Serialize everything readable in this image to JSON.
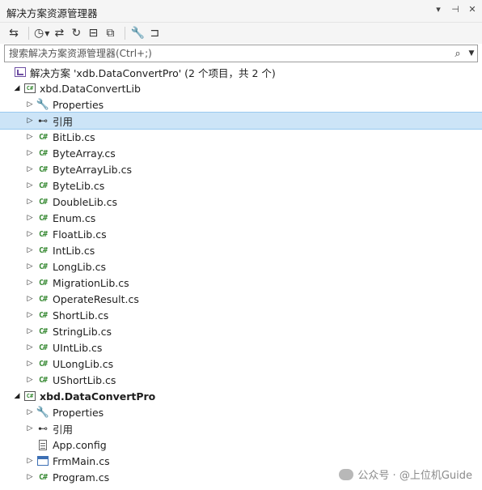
{
  "window": {
    "title": "解决方案资源管理器"
  },
  "title_actions": [
    {
      "name": "dropdown-icon",
      "glyph": "▾"
    },
    {
      "name": "pin-icon",
      "glyph": "⊣"
    },
    {
      "name": "close-icon",
      "glyph": "✕"
    }
  ],
  "search": {
    "placeholder": "搜索解决方案资源管理器(Ctrl+;)"
  },
  "tree": [
    {
      "level": 0,
      "expander": "",
      "icon": "solution-icon",
      "label": "解决方案 'xdb.DataConvertPro' (2 个项目，共 2 个)",
      "bold": false
    },
    {
      "level": 1,
      "expander": "expanded",
      "icon": "csharp-project-icon",
      "label": "xbd.DataConvertLib",
      "bold": false
    },
    {
      "level": 2,
      "expander": "collapsed",
      "icon": "wrench-icon",
      "label": "Properties",
      "bold": false
    },
    {
      "level": 2,
      "expander": "collapsed",
      "icon": "references-icon",
      "label": "引用",
      "bold": false,
      "selected": true
    },
    {
      "level": 2,
      "expander": "collapsed",
      "icon": "csharp-file-icon",
      "label": "BitLib.cs",
      "bold": false
    },
    {
      "level": 2,
      "expander": "collapsed",
      "icon": "csharp-file-icon",
      "label": "ByteArray.cs",
      "bold": false
    },
    {
      "level": 2,
      "expander": "collapsed",
      "icon": "csharp-file-icon",
      "label": "ByteArrayLib.cs",
      "bold": false
    },
    {
      "level": 2,
      "expander": "collapsed",
      "icon": "csharp-file-icon",
      "label": "ByteLib.cs",
      "bold": false
    },
    {
      "level": 2,
      "expander": "collapsed",
      "icon": "csharp-file-icon",
      "label": "DoubleLib.cs",
      "bold": false
    },
    {
      "level": 2,
      "expander": "collapsed",
      "icon": "csharp-file-icon",
      "label": "Enum.cs",
      "bold": false
    },
    {
      "level": 2,
      "expander": "collapsed",
      "icon": "csharp-file-icon",
      "label": "FloatLib.cs",
      "bold": false
    },
    {
      "level": 2,
      "expander": "collapsed",
      "icon": "csharp-file-icon",
      "label": "IntLib.cs",
      "bold": false
    },
    {
      "level": 2,
      "expander": "collapsed",
      "icon": "csharp-file-icon",
      "label": "LongLib.cs",
      "bold": false
    },
    {
      "level": 2,
      "expander": "collapsed",
      "icon": "csharp-file-icon",
      "label": "MigrationLib.cs",
      "bold": false
    },
    {
      "level": 2,
      "expander": "collapsed",
      "icon": "csharp-file-icon",
      "label": "OperateResult.cs",
      "bold": false
    },
    {
      "level": 2,
      "expander": "collapsed",
      "icon": "csharp-file-icon",
      "label": "ShortLib.cs",
      "bold": false
    },
    {
      "level": 2,
      "expander": "collapsed",
      "icon": "csharp-file-icon",
      "label": "StringLib.cs",
      "bold": false
    },
    {
      "level": 2,
      "expander": "collapsed",
      "icon": "csharp-file-icon",
      "label": "UIntLib.cs",
      "bold": false
    },
    {
      "level": 2,
      "expander": "collapsed",
      "icon": "csharp-file-icon",
      "label": "ULongLib.cs",
      "bold": false
    },
    {
      "level": 2,
      "expander": "collapsed",
      "icon": "csharp-file-icon",
      "label": "UShortLib.cs",
      "bold": false
    },
    {
      "level": 1,
      "expander": "expanded",
      "icon": "csharp-project-icon",
      "label": "xbd.DataConvertPro",
      "bold": true
    },
    {
      "level": 2,
      "expander": "collapsed",
      "icon": "wrench-icon",
      "label": "Properties",
      "bold": false
    },
    {
      "level": 2,
      "expander": "collapsed",
      "icon": "references-icon",
      "label": "引用",
      "bold": false
    },
    {
      "level": 2,
      "expander": "",
      "icon": "config-file-icon",
      "label": "App.config",
      "bold": false
    },
    {
      "level": 2,
      "expander": "collapsed",
      "icon": "form-icon",
      "label": "FrmMain.cs",
      "bold": false
    },
    {
      "level": 2,
      "expander": "collapsed",
      "icon": "csharp-file-icon",
      "label": "Program.cs",
      "bold": false
    }
  ],
  "watermark": {
    "text": "公众号 · @上位机Guide"
  },
  "colors": {
    "selected_bg": "#cce4f7",
    "csharp_green": "#388a34",
    "title_bg": "#f5f5f5"
  }
}
